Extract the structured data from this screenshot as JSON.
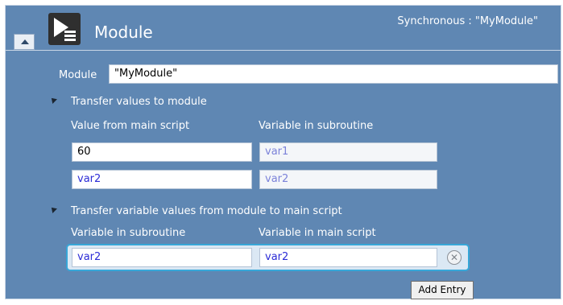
{
  "header": {
    "title": "Module",
    "sync_text": "Synchronous : \"MyModule\"",
    "icon": "module-icon"
  },
  "module_field": {
    "label": "Module",
    "value": "\"MyModule\""
  },
  "transfer_to_module": {
    "title": "Transfer values to module",
    "col1_header": "Value from main script",
    "col2_header": "Variable in subroutine",
    "rows": [
      {
        "from_main": "60",
        "to_sub": "var1"
      },
      {
        "from_main": "var2",
        "to_sub": "var2"
      }
    ]
  },
  "transfer_to_main": {
    "title": "Transfer variable values from module to main script",
    "col1_header": "Variable in subroutine",
    "col2_header": "Variable in main script",
    "rows": [
      {
        "from_sub": "var2",
        "to_main": "var2"
      }
    ],
    "remove_icon": "remove-circle-icon"
  },
  "add_entry_label": "Add Entry",
  "colors": {
    "panel_bg": "#5f87b3",
    "field_text_blue": "#2c2cd6",
    "highlight_border": "#37a7d8"
  }
}
